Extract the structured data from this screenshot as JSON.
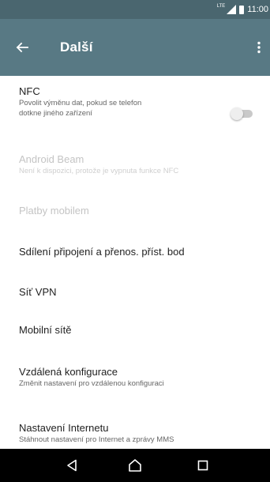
{
  "status_bar": {
    "network": "LTE",
    "time": "11:00",
    "icons": [
      "lte-icon",
      "signal-icon",
      "battery-icon"
    ]
  },
  "app_bar": {
    "title": "Další",
    "back_icon": "arrow-left-icon",
    "menu_icon": "more-vert-icon",
    "color": "#587984"
  },
  "settings": [
    {
      "title": "NFC",
      "subtitle_lines": [
        "Povolit výměnu dat, pokud se telefon",
        "dotkne jiného zařízení"
      ],
      "enabled": true,
      "toggle": false
    },
    {
      "title": "Android Beam",
      "subtitle_lines": [
        "Není k dispozici, protože je vypnuta funkce NFC"
      ],
      "enabled": false
    },
    {
      "title": "Platby mobilem",
      "subtitle_lines": [],
      "enabled": false
    },
    {
      "title": "Sdílení připojení a přenos. příst. bod",
      "subtitle_lines": [],
      "enabled": true
    },
    {
      "title": "Síť VPN",
      "subtitle_lines": [],
      "enabled": true
    },
    {
      "title": "Mobilní sítě",
      "subtitle_lines": [],
      "enabled": true
    },
    {
      "title": "Vzdálená konfigurace",
      "subtitle_lines": [
        "Změnit nastavení pro vzdálenou konfiguraci"
      ],
      "enabled": true
    },
    {
      "title": "Nastavení Internetu",
      "subtitle_lines": [
        "Stáhnout nastavení pro Internet a zprávy MMS"
      ],
      "enabled": true
    }
  ],
  "nav_bar": {
    "icons": [
      "back-triangle-icon",
      "home-icon",
      "recents-icon"
    ]
  }
}
